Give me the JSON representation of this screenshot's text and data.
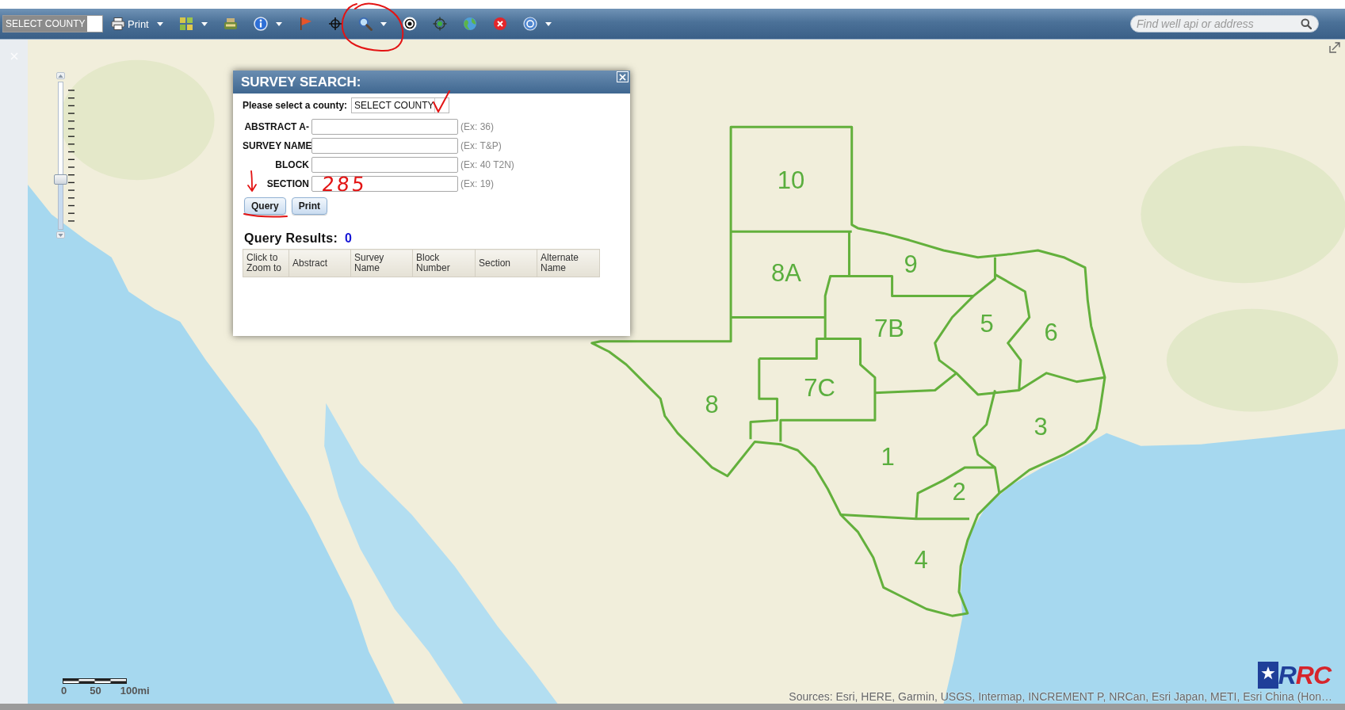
{
  "toolbar": {
    "county_select": {
      "value": "SELECT COUNTY"
    },
    "tools": [
      {
        "kind": "print",
        "label": "Print",
        "dropdown": true
      },
      {
        "kind": "layers",
        "dropdown": true
      },
      {
        "kind": "export",
        "dropdown": false
      },
      {
        "kind": "info",
        "dropdown": true
      },
      {
        "kind": "flag",
        "dropdown": false
      },
      {
        "kind": "crosshair",
        "dropdown": false
      },
      {
        "kind": "search",
        "dropdown": true
      },
      {
        "kind": "target",
        "dropdown": false
      },
      {
        "kind": "locate",
        "dropdown": false
      },
      {
        "kind": "globe",
        "dropdown": false
      },
      {
        "kind": "clear",
        "dropdown": false
      },
      {
        "kind": "help",
        "dropdown": true
      }
    ],
    "search": {
      "placeholder": "Find well api or address"
    }
  },
  "zoom_slider": {
    "level": 0.33
  },
  "districts": [
    {
      "label": "10"
    },
    {
      "label": "8A"
    },
    {
      "label": "9"
    },
    {
      "label": "7B"
    },
    {
      "label": "5"
    },
    {
      "label": "6"
    },
    {
      "label": "7C"
    },
    {
      "label": "8"
    },
    {
      "label": "3"
    },
    {
      "label": "1"
    },
    {
      "label": "2"
    },
    {
      "label": "4"
    }
  ],
  "scale_bar": {
    "labels": [
      "0",
      "50",
      "100mi"
    ]
  },
  "attribution": "Sources: Esri, HERE, Garmin, USGS, Intermap, INCREMENT P, NRCan, Esri Japan, METI, Esri China (Hon…",
  "logo": {
    "text": "RRC"
  },
  "dialog": {
    "title": "SURVEY SEARCH:",
    "county": {
      "label": "Please select a county:",
      "value": "SELECT COUNTY"
    },
    "fields": [
      {
        "label": "ABSTRACT A-",
        "hint": "(Ex: 36)"
      },
      {
        "label": "SURVEY NAME",
        "hint": "(Ex: T&P)"
      },
      {
        "label": "BLOCK",
        "hint": "(Ex: 40 T2N)"
      },
      {
        "label": "SECTION",
        "hint": "(Ex: 19)"
      }
    ],
    "buttons": [
      "Query",
      "Print"
    ],
    "results": {
      "label": "Query Results:",
      "count": "0"
    },
    "table": {
      "columns": [
        "Click to Zoom to",
        "Abstract",
        "Survey Name",
        "Block Number",
        "Section",
        "Alternate Name"
      ]
    }
  },
  "annotations": [
    {
      "kind": "circle"
    },
    {
      "kind": "check"
    },
    {
      "kind": "arrow"
    },
    {
      "kind": "underline"
    },
    {
      "kind": "note",
      "text": "285"
    }
  ]
}
